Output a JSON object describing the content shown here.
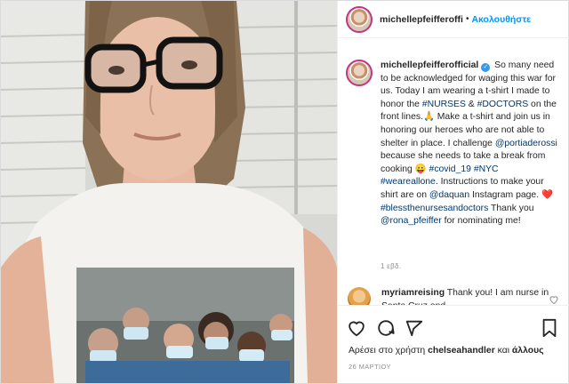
{
  "header": {
    "username": "michellepfeifferoffi",
    "separator": "•",
    "follow_label": "Ακολουθήστε"
  },
  "caption": {
    "username": "michellepfeifferofficial",
    "t1": " So many need to be acknowledged for waging this war for us. Today I am wearing a t-shirt I made to honor the ",
    "tag_nurses": "#NURSES",
    "t2": " & ",
    "tag_doctors": "#DOCTORS",
    "t3": " on the front lines.",
    "emoji_pray": "🙏",
    "t4": " Make a t-shirt and join us in honoring our heroes who are not able to shelter in place. I challenge ",
    "mention_portia": "@portiaderossi",
    "t5": " because she needs to take a break from cooking ",
    "emoji_cooking": "😛",
    "tag_covid": "#covid_19",
    "tag_nyc": "#NYC",
    "tag_wearealone": "#weareallone",
    "t6": ". Instructions to make your shirt are on ",
    "mention_daquan": "@daquan",
    "t7": " Instagram page. ",
    "emoji_heart": "❤️",
    "tag_bless": "#blessthenursesandoctors",
    "t8": " Thank you ",
    "mention_rona": "@rona_pfeiffer",
    "t9": " for nominating me!",
    "time": "1 εβδ."
  },
  "comment": {
    "username": "myriamreising",
    "text": " Thank you! I am nurse in Santa Cruz and"
  },
  "actions": {
    "like_icon": "heart-icon",
    "comment_icon": "comment-icon",
    "share_icon": "share-icon",
    "save_icon": "bookmark-icon"
  },
  "likes": {
    "prefix": "Αρέσει στο χρήστη ",
    "user": "chelseahandler",
    "middle": " και ",
    "others": "άλλους"
  },
  "date": "26 ΜΑΡΤΙΟΥ",
  "colors": {
    "link": "#00376b",
    "follow": "#0095f6",
    "verified": "#3897f0",
    "border": "#dbdbdb"
  }
}
